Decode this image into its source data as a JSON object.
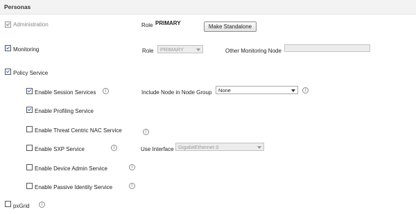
{
  "section": {
    "title": "Personas"
  },
  "administration": {
    "label": "Administration",
    "checked": true,
    "disabled": true,
    "role_label": "Role",
    "role_value": "PRIMARY",
    "make_standalone_label": "Make Standalone"
  },
  "monitoring": {
    "label": "Monitoring",
    "checked": true,
    "role_label": "Role",
    "role_select_value": "PRIMARY",
    "other_node_label": "Other Monitoring Node",
    "other_node_value": ""
  },
  "policy_service": {
    "label": "Policy Service",
    "checked": true,
    "options": [
      {
        "label": "Enable Session Services",
        "checked": true,
        "info": true
      },
      {
        "label": "Enable Profiling Service",
        "checked": true,
        "info": false
      },
      {
        "label": "Enable Threat Centric NAC Service",
        "checked": false,
        "info": true
      },
      {
        "label": "Enable SXP Service",
        "checked": false,
        "info": true
      },
      {
        "label": "Enable Device Admin Service",
        "checked": false,
        "info": true
      },
      {
        "label": "Enable Passive Identity Service",
        "checked": false,
        "info": true
      }
    ],
    "node_group_label": "Include Node in Node Group",
    "node_group_value": "None",
    "use_interface_label": "Use Interface",
    "use_interface_value": "GigabitEthernet 0"
  },
  "pxgrid": {
    "label": "pxGrid",
    "checked": false
  },
  "icons": {
    "info": "info-icon",
    "dropdown": "chevron-down-icon"
  },
  "colors": {
    "check_accent": "#2a6fd6",
    "header_bg": "#f3f3f3"
  }
}
